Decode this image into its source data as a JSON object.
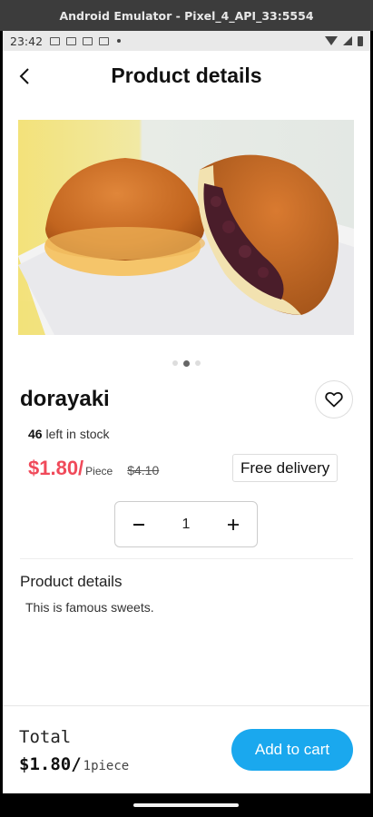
{
  "window": {
    "title": "Android Emulator - Pixel_4_API_33:5554"
  },
  "status_bar": {
    "time": "23:42",
    "icons": [
      "gmail-icon",
      "notification-icon",
      "notification-icon",
      "notification-icon",
      "dot-icon"
    ],
    "right_icons": [
      "wifi-icon",
      "signal-icon",
      "battery-icon"
    ]
  },
  "header": {
    "title": "Product details",
    "back_icon": "arrow-left-icon"
  },
  "product": {
    "image_alt": "dorayaki",
    "carousel": {
      "count": 3,
      "active": 2
    },
    "name": "dorayaki",
    "favorite_icon": "heart-outline-icon",
    "stock_count": "46",
    "stock_text": " left in stock",
    "price": "$1.80/",
    "price_unit": "Piece",
    "old_price": "$4.10",
    "delivery_badge": "Free delivery",
    "quantity": "1",
    "details_heading": "Product details",
    "description": "This is famous sweets."
  },
  "footer": {
    "total_label": "Total",
    "total_price": "$1.80/",
    "total_unit": "1piece",
    "add_to_cart": "Add to cart"
  },
  "colors": {
    "accent": "#1aa8ee",
    "price": "#f04a5a"
  }
}
